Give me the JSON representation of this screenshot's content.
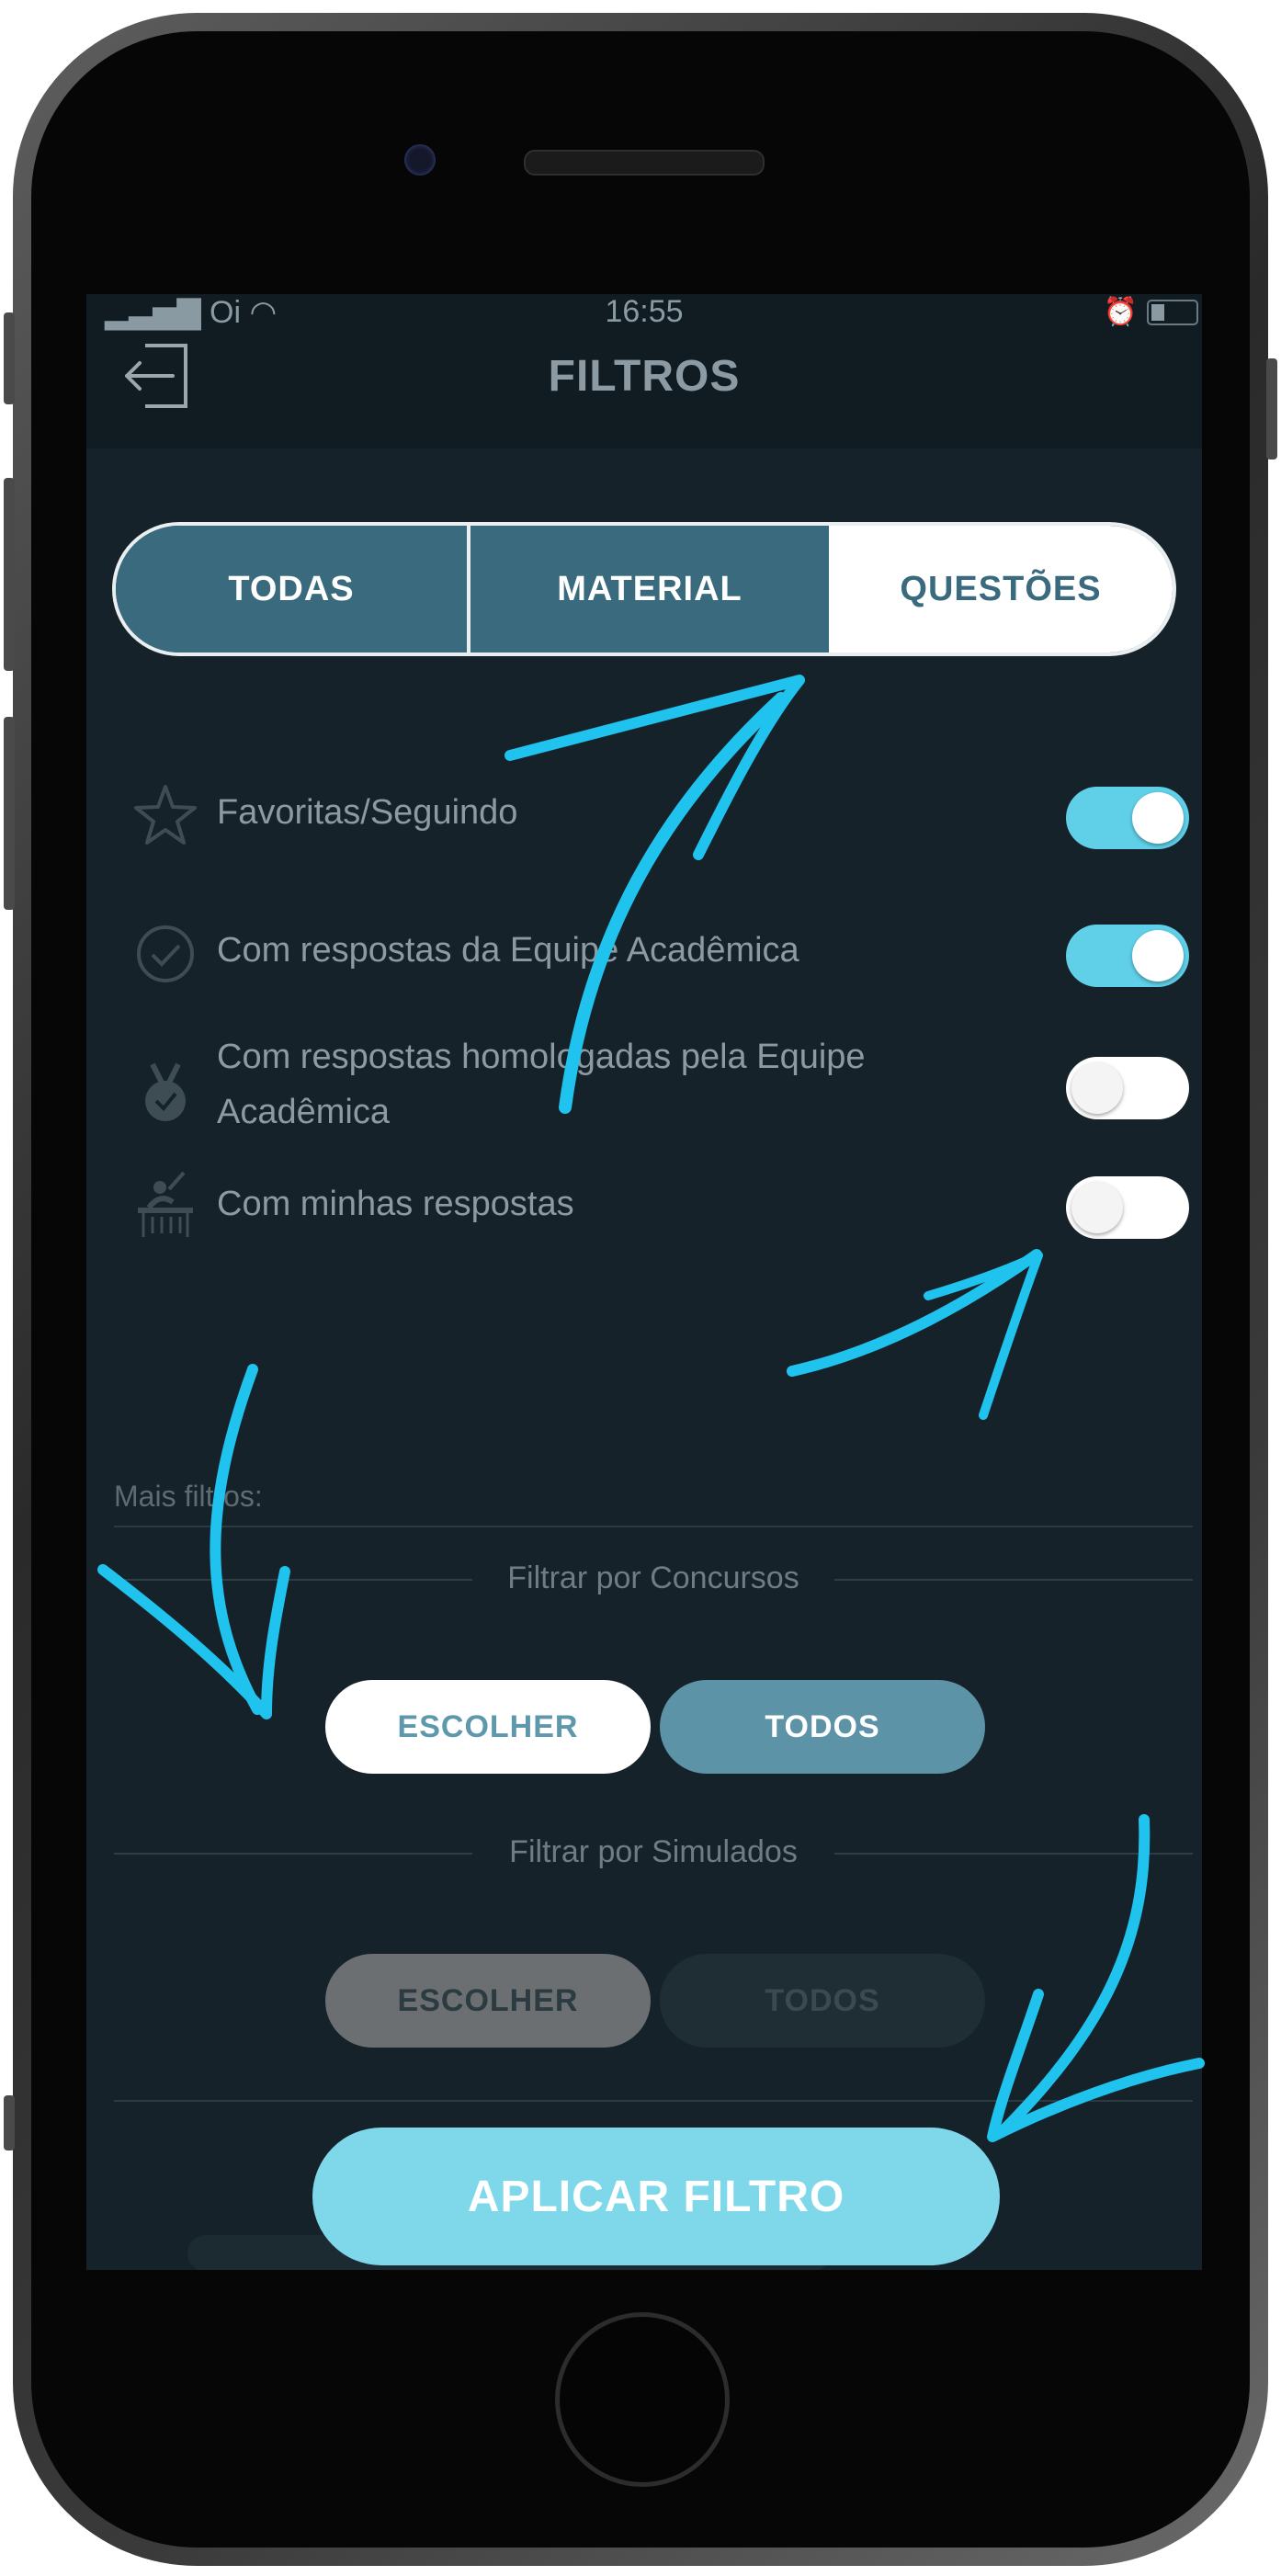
{
  "status_bar": {
    "carrier": "Oi",
    "time": "16:55"
  },
  "header": {
    "title": "FILTROS"
  },
  "segments": [
    "TODAS",
    "MATERIAL",
    "QUESTÕES"
  ],
  "options": [
    {
      "label": "Favoritas/Seguindo",
      "icon": "star-icon",
      "on": true
    },
    {
      "label": "Com respostas da Equipe Acadêmica",
      "icon": "check-circle-icon",
      "on": true
    },
    {
      "label_line1": "Com respostas homologadas pela Equipe",
      "label_line2": "Acadêmica",
      "icon": "medal-icon",
      "on": false
    },
    {
      "label": "Com minhas respostas",
      "icon": "student-desk-icon",
      "on": false
    }
  ],
  "more_filters": {
    "label": "Mais filtros:"
  },
  "concursos": {
    "title": "Filtrar por Concursos",
    "choose": "ESCOLHER",
    "all": "TODOS"
  },
  "simulados": {
    "title": "Filtrar por Simulados",
    "choose": "ESCOLHER",
    "all": "TODOS"
  },
  "apply_button": "APLICAR FILTRO",
  "colors": {
    "accent": "#5fd0e8",
    "segment": "#3a6a7d",
    "background": "#16222a",
    "arrows": "#1fc3ee"
  }
}
